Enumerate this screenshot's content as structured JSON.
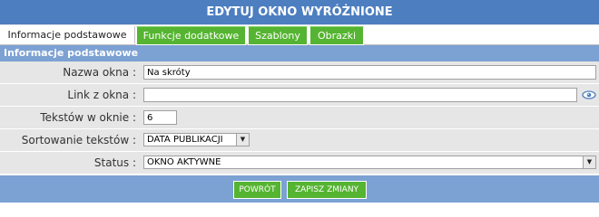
{
  "header": {
    "title": "EDYTUJ OKNO WYRÓŻNIONE"
  },
  "tabs": [
    {
      "label": "Informacje podstawowe"
    },
    {
      "label": "Funkcje dodatkowe"
    },
    {
      "label": "Szablony"
    },
    {
      "label": "Obrazki"
    }
  ],
  "section": {
    "title": "Informacje podstawowe"
  },
  "form": {
    "nazwa_okna": {
      "label": "Nazwa okna :",
      "value": "Na skróty"
    },
    "link_z_okna": {
      "label": "Link z okna :",
      "value": ""
    },
    "tekstow_w_oknie": {
      "label": "Tekstów w oknie :",
      "value": "6"
    },
    "sortowanie": {
      "label": "Sortowanie tekstów :",
      "value": "DATA PUBLIKACJI"
    },
    "status": {
      "label": "Status :",
      "value": "OKNO AKTYWNE"
    }
  },
  "buttons": {
    "back": "POWRÓT",
    "save": "ZAPISZ ZMIANY"
  },
  "colors": {
    "header": "#4d7ec0",
    "section": "#7ca1d3",
    "tab_green": "#55b431",
    "row_bg": "#e6e6e6"
  }
}
